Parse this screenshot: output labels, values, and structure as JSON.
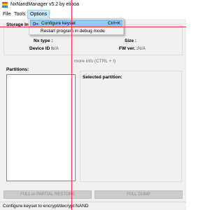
{
  "window": {
    "title": "NxNandManager v5.2 by eliboa",
    "icon": "nx-rainbow-logo-icon"
  },
  "menubar": {
    "items": [
      {
        "label": "File",
        "state": "normal"
      },
      {
        "label": "Tools",
        "state": "normal"
      },
      {
        "label": "Options",
        "state": "open"
      }
    ]
  },
  "options_menu": {
    "items": [
      {
        "label": "Configure keyset",
        "shortcut": "Ctrl+K",
        "icon": "key-icon",
        "highlighted": true
      },
      {
        "label": "Restart program in debug mode",
        "shortcut": "",
        "icon": "",
        "highlighted": false
      }
    ]
  },
  "storage_info": {
    "legend": "Storage In",
    "nx_type_label": "Nx type :",
    "size_label": "Size :",
    "device_id_label": "Device ID :",
    "device_id_value": "N/A",
    "fw_ver_label": "FW ver. :",
    "fw_ver_value": "N/A"
  },
  "more_info_link": "more info (CTRL + I)",
  "partitions": {
    "label": "Partitions:"
  },
  "selected_partition": {
    "label": "Selected partition:"
  },
  "buttons": {
    "full_restore": "FULL or PARTIAL RESTORE",
    "full_dump": "FULL DUMP"
  },
  "statusbar": {
    "text": "Configure keyset to encrypt/decrypt NAND"
  },
  "colors": {
    "menu_hover": "#cce8ff",
    "dropdown_highlight": "#91c9f7",
    "guide_line": "#ff2d2d",
    "window_bg": "#f0f0f0"
  }
}
